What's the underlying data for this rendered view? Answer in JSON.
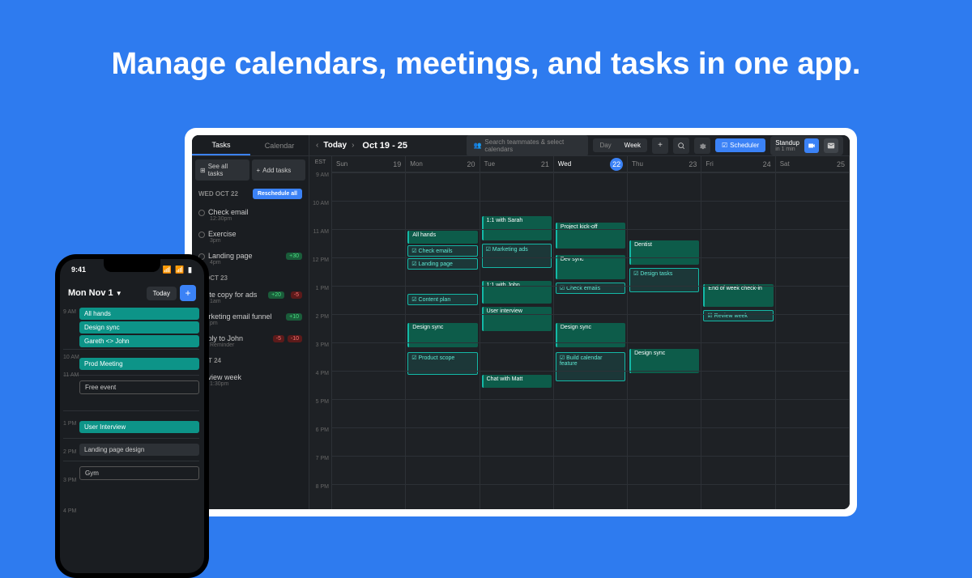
{
  "headline": "Manage calendars, meetings, and tasks in one app.",
  "tablet": {
    "sidebar": {
      "tabs": {
        "tasks": "Tasks",
        "calendar": "Calendar"
      },
      "see_all": "See all tasks",
      "add_tasks": "Add tasks",
      "day1": {
        "label": "WED OCT 22",
        "reschedule": "Reschedule all"
      },
      "t1": {
        "title": "Check email",
        "time": "12:30pm"
      },
      "t2": {
        "title": "Exercise",
        "time": "3pm"
      },
      "t3": {
        "title": "Landing page",
        "time": "4pm",
        "badge": "+30"
      },
      "day2": {
        "label": "U OCT 23"
      },
      "t4": {
        "title": "Write copy for ads",
        "time": "1am",
        "badge1": "-5",
        "badge2": "+20"
      },
      "t5": {
        "title": "Marketing email funnel",
        "time": "pm",
        "badge": "+10"
      },
      "t6": {
        "title": "Reply to John",
        "time": "Reminder",
        "badge1": "-5",
        "badge2": "-10"
      },
      "day3": {
        "label": "OCT 24"
      },
      "t7": {
        "title": "Review week",
        "time": "1:30pm"
      }
    },
    "topbar": {
      "today": "Today",
      "range": "Oct 19 - 25",
      "search_placeholder": "Search teammates & select calendars",
      "day": "Day",
      "week": "Week",
      "scheduler": "Scheduler",
      "standup": "Standup",
      "standup_sub": "in 1 min"
    },
    "calendar": {
      "tz": "EST",
      "hours": [
        "9 AM",
        "10 AM",
        "11 AM",
        "12 PM",
        "1 PM",
        "2 PM",
        "3 PM",
        "4 PM",
        "5 PM",
        "6 PM",
        "7 PM",
        "8 PM"
      ],
      "days": [
        {
          "name": "Sun",
          "num": "19"
        },
        {
          "name": "Mon",
          "num": "20"
        },
        {
          "name": "Tue",
          "num": "21"
        },
        {
          "name": "Wed",
          "num": "22",
          "today": true
        },
        {
          "name": "Thu",
          "num": "23"
        },
        {
          "name": "Fri",
          "num": "24"
        },
        {
          "name": "Sat",
          "num": "25"
        }
      ],
      "events": {
        "all_hands": "All hands",
        "check_emails": "Check emails",
        "landing_page": "Landing page",
        "content_plan": "Content plan",
        "design_sync": "Design sync",
        "product_scope": "Product scope",
        "sarah": "1:1 with Sarah",
        "marketing": "Marketing ads",
        "john": "1:1 with John",
        "user_interview": "User interview",
        "chat_matt": "Chat with Matt",
        "kickoff": "Project kick-off",
        "dev_sync": "Dev sync",
        "build_cal": "Build calendar feature",
        "dentist": "Dentist",
        "design_tasks": "Design tasks",
        "end_week": "End of week check-in",
        "review_week": "Review week"
      }
    }
  },
  "phone": {
    "time": "9:41",
    "date": "Mon Nov 1",
    "today": "Today",
    "hours": {
      "h9": "9 AM",
      "h10": "10 AM",
      "h11": "11 AM",
      "h1": "1 PM",
      "h2": "2 PM",
      "h3": "3 PM",
      "h4": "4 PM"
    },
    "events": {
      "all_hands": "All hands",
      "design_sync": "Design sync",
      "gareth": "Gareth <> John",
      "prod": "Prod Meeting",
      "free": "Free event",
      "user_int": "User Interview",
      "landing": "Landing page design",
      "gym": "Gym"
    }
  }
}
